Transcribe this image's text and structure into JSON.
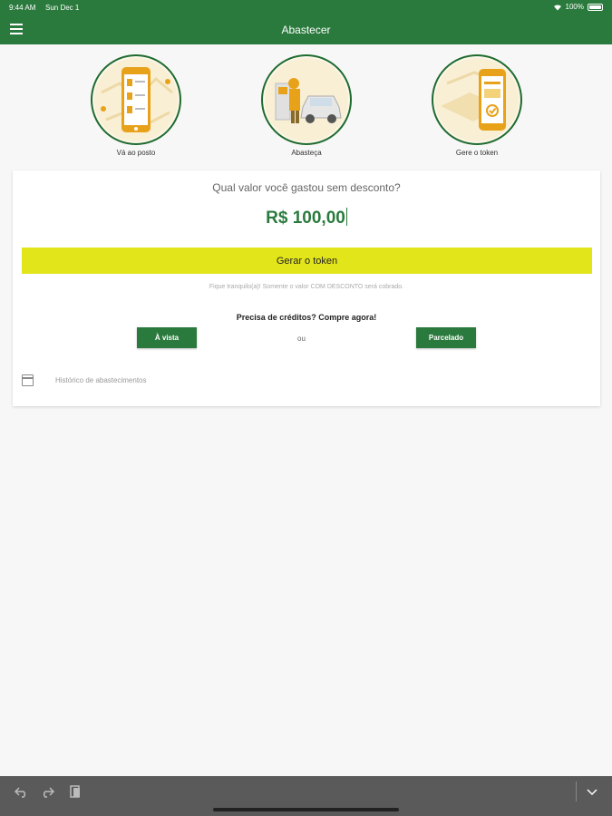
{
  "status": {
    "time": "9:44 AM",
    "date": "Sun Dec 1",
    "battery": "100%"
  },
  "header": {
    "title": "Abastecer"
  },
  "steps": [
    {
      "label": "Vá ao posto"
    },
    {
      "label": "Abasteça"
    },
    {
      "label": "Gere o token"
    }
  ],
  "form": {
    "question": "Qual valor você gastou sem desconto?",
    "amount": "R$ 100,00",
    "token_button": "Gerar o token",
    "note": "Fique tranquilo(a)! Somente o valor COM DESCONTO será cobrado.",
    "credits_title": "Precisa de créditos? Compre agora!",
    "avista_button": "À vista",
    "or_label": "ou",
    "parcelado_button": "Parcelado",
    "history_label": "Histórico de abastecimentos"
  },
  "colors": {
    "primary": "#2b7a3d",
    "accent": "#e3e51b"
  },
  "icons": {
    "menu": "hamburger-icon",
    "calendar": "calendar-icon",
    "undo": "undo-icon",
    "redo": "redo-icon",
    "paste": "paste-icon",
    "dismiss": "chevron-down-icon"
  }
}
